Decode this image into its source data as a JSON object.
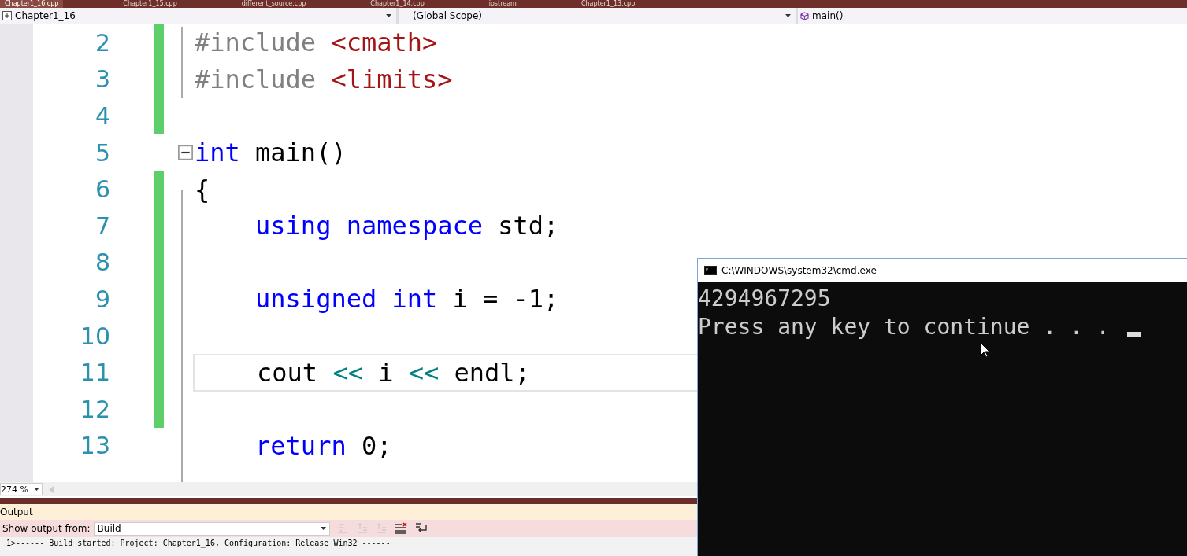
{
  "tabs": [
    {
      "label": "Chapter1_16.cpp",
      "selected": true
    },
    {
      "label": "Chapter1_15.cpp",
      "selected": false
    },
    {
      "label": "different_source.cpp",
      "selected": false
    },
    {
      "label": "Chapter1_14.cpp",
      "selected": false
    },
    {
      "label": "iostream",
      "selected": false
    },
    {
      "label": "Chapter1_13.cpp",
      "selected": false
    }
  ],
  "nav": {
    "project": "Chapter1_16",
    "scope": "(Global Scope)",
    "member": "main()"
  },
  "editor": {
    "lines": [
      {
        "number": "2",
        "changed": true,
        "current": false,
        "fold": false,
        "tokens": [
          {
            "kind": "preprocessor",
            "text": "#include "
          },
          {
            "kind": "string",
            "text": "<cmath>"
          }
        ]
      },
      {
        "number": "3",
        "changed": true,
        "current": false,
        "fold": false,
        "tokens": [
          {
            "kind": "preprocessor",
            "text": "#include "
          },
          {
            "kind": "string",
            "text": "<limits>"
          }
        ]
      },
      {
        "number": "4",
        "changed": true,
        "current": false,
        "fold": false
      },
      {
        "number": "5",
        "changed": false,
        "current": false,
        "fold": true,
        "tokens": [
          {
            "kind": "keyword",
            "text": "int"
          },
          {
            "kind": "plain",
            "text": " main()"
          }
        ]
      },
      {
        "number": "6",
        "changed": true,
        "current": false,
        "fold": false,
        "tokens": [
          {
            "kind": "plain",
            "text": "{"
          }
        ]
      },
      {
        "number": "7",
        "changed": true,
        "current": false,
        "fold": false,
        "tokens": [
          {
            "kind": "keyword",
            "text": "    using namespace"
          },
          {
            "kind": "plain",
            "text": " std;"
          }
        ]
      },
      {
        "number": "8",
        "changed": true,
        "current": false,
        "fold": false
      },
      {
        "number": "9",
        "changed": true,
        "current": false,
        "fold": false,
        "tokens": [
          {
            "kind": "keyword",
            "text": "    unsigned int"
          },
          {
            "kind": "plain",
            "text": " i = -1;"
          }
        ]
      },
      {
        "number": "10",
        "changed": true,
        "current": false,
        "fold": false
      },
      {
        "number": "11",
        "changed": true,
        "current": true,
        "fold": false,
        "tokens": [
          {
            "kind": "plain",
            "text": "    cout "
          },
          {
            "kind": "operator",
            "text": "<<"
          },
          {
            "kind": "plain",
            "text": " i "
          },
          {
            "kind": "operator",
            "text": "<<"
          },
          {
            "kind": "plain",
            "text": " endl;"
          }
        ]
      },
      {
        "number": "12",
        "changed": true,
        "current": false,
        "fold": false
      },
      {
        "number": "13",
        "changed": false,
        "current": false,
        "fold": false,
        "tokens": [
          {
            "kind": "keyword",
            "text": "    return"
          },
          {
            "kind": "plain",
            "text": " 0;"
          }
        ]
      }
    ]
  },
  "zoom": "274 %",
  "console": {
    "title": "C:\\WINDOWS\\system32\\cmd.exe",
    "lines": [
      "4294967295",
      "Press any key to continue . . ."
    ]
  },
  "output": {
    "title": "Output",
    "source_label": "Show output from:",
    "source": "Build",
    "lines": [
      "1>------ Build started: Project: Chapter1_16, Configuration: Release Win32 ------"
    ]
  }
}
